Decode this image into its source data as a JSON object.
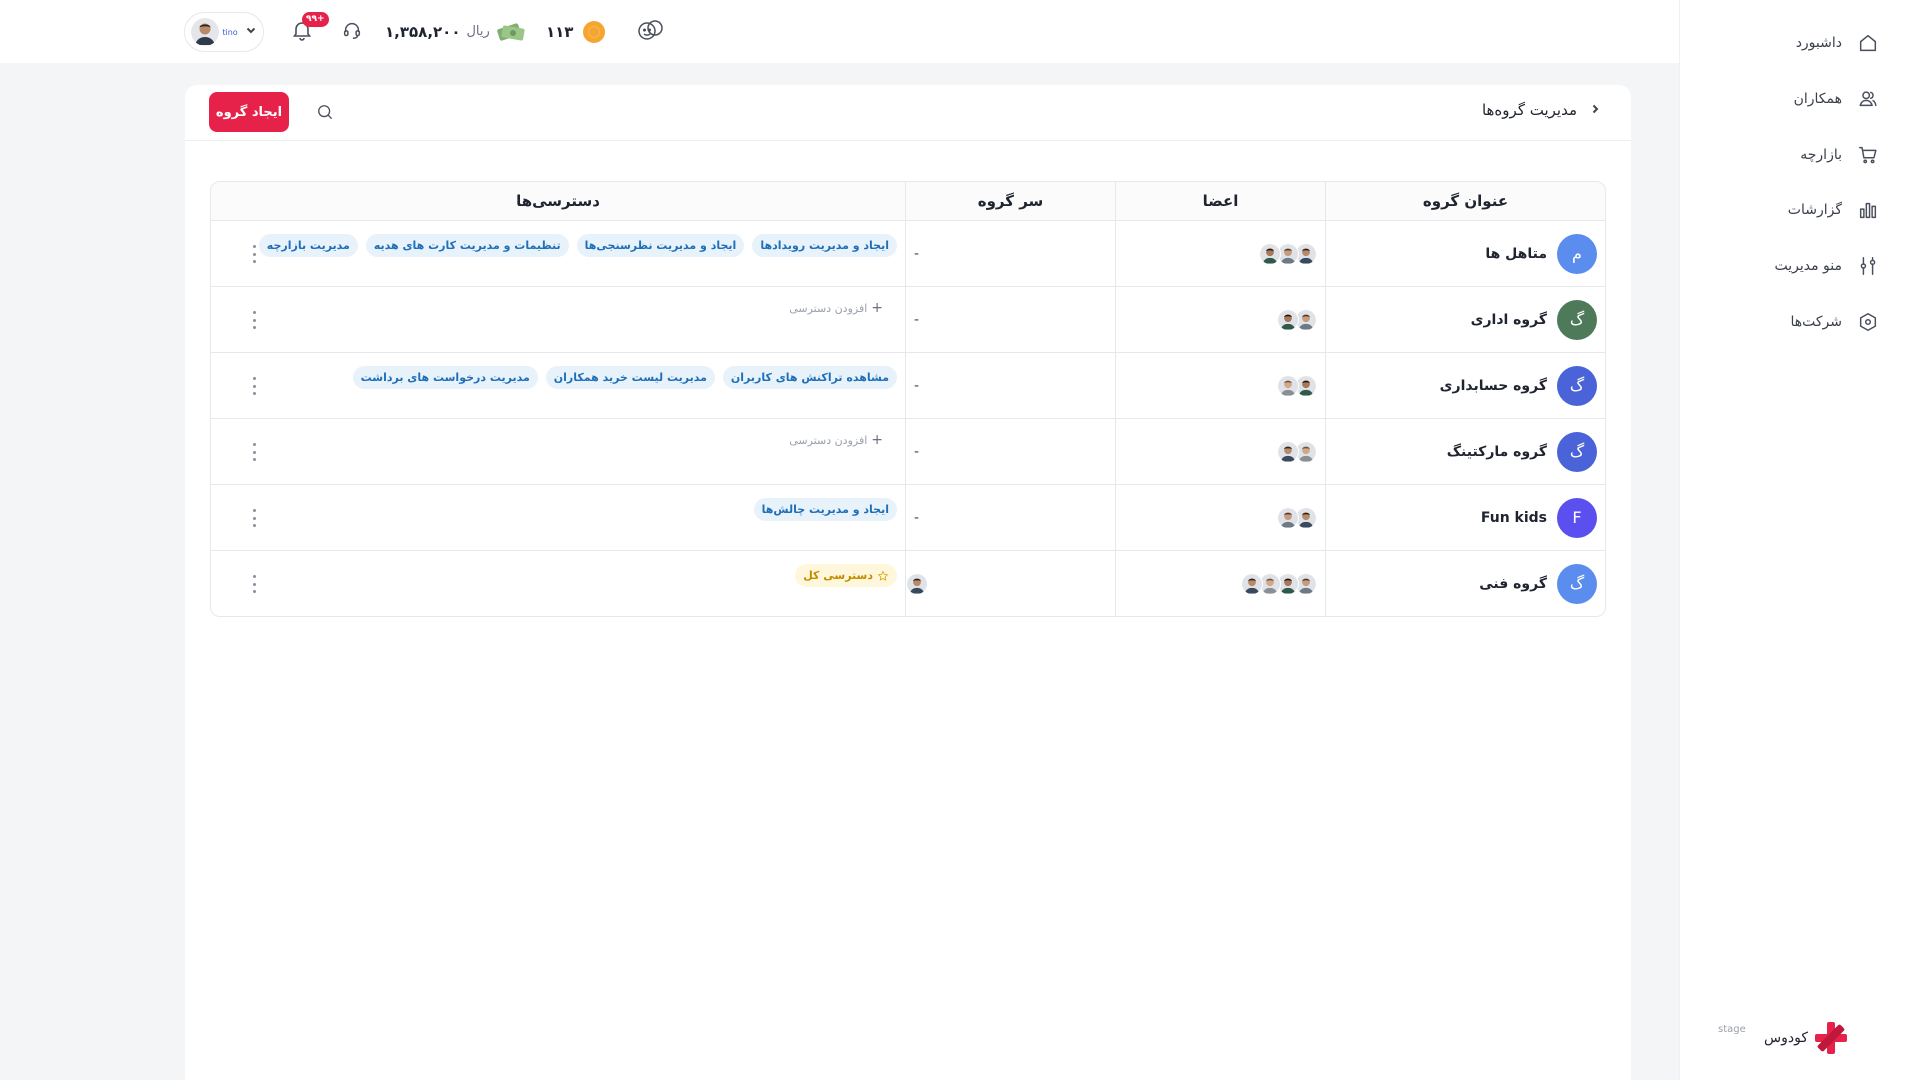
{
  "sidebar": {
    "items": [
      {
        "label": "داشبورد",
        "icon": "home-icon"
      },
      {
        "label": "همکاران",
        "icon": "users-icon"
      },
      {
        "label": "بازارچه",
        "icon": "cart-icon"
      },
      {
        "label": "گزارشات",
        "icon": "chart-icon"
      },
      {
        "label": "منو مدیریت",
        "icon": "sliders-icon"
      },
      {
        "label": "شرکت‌ها",
        "icon": "hexagon-icon"
      }
    ],
    "brand": {
      "name": "کودوس",
      "tag": "stage"
    }
  },
  "topbar": {
    "user_handle": "tino",
    "notifications_badge": "+۹۹",
    "wallet_amount": "۱,۳۵۸,۲۰۰",
    "wallet_currency": "ریال",
    "coins": "۱۱۳"
  },
  "page": {
    "title": "مدیریت گروه‌ها",
    "create_button": "ایجاد گروه"
  },
  "table": {
    "headers": {
      "title": "عنوان گروه",
      "members": "اعضا",
      "lead": "سر گروه",
      "permissions": "دسترسی‌ها"
    },
    "add_permission_label": "افزودن دسترسی",
    "rows": [
      {
        "initial": "م",
        "color": "#5b8def",
        "name": "متاهل ها",
        "members": 3,
        "lead": "-",
        "permissions": [
          "ایجاد و مدیریت رویدادها",
          "ایجاد و مدیریت نظرسنجی‌ها",
          "تنظیمات و مدیریت کارت های هدیه",
          "مدیریت بازارچه"
        ]
      },
      {
        "initial": "گ",
        "color": "#4f7a5a",
        "name": "گروه اداری",
        "members": 2,
        "lead": "-",
        "permissions": []
      },
      {
        "initial": "گ",
        "color": "#4b63d8",
        "name": "گروه حسابداری",
        "members": 2,
        "lead": "-",
        "permissions": [
          "مشاهده تراکنش های کاربران",
          "مدیریت لیست خرید همکاران",
          "مدیریت درخواست های برداشت"
        ]
      },
      {
        "initial": "گ",
        "color": "#4b63d8",
        "name": "گروه مارکتینگ",
        "members": 2,
        "lead": "-",
        "permissions": []
      },
      {
        "initial": "F",
        "color": "#5b4ff0",
        "name": "Fun kids",
        "members": 2,
        "lead": "-",
        "permissions": [
          "ایجاد و مدیریت چالش‌ها"
        ]
      },
      {
        "initial": "گ",
        "color": "#5b8def",
        "name": "گروه فنی",
        "members": 4,
        "lead": "avatar",
        "permissions": [],
        "special_permission": "دسترسی کل"
      }
    ]
  },
  "colors": {
    "accent": "#e6224b",
    "chip_bg": "#e8f2fb",
    "chip_text": "#1f6fb8",
    "gold": "#c48d00"
  }
}
